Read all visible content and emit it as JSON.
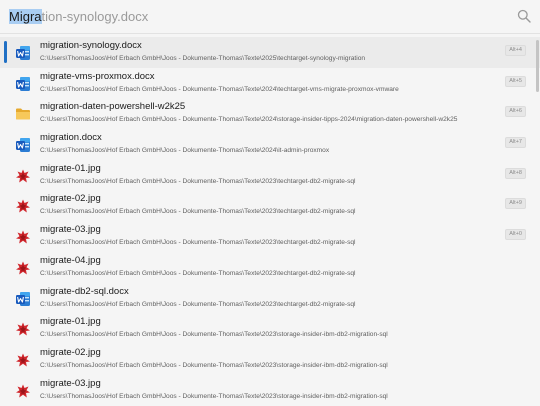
{
  "search": {
    "typed": "Migra",
    "completion": "tion-synology.docx"
  },
  "results": [
    {
      "title": "migration-synology.docx",
      "path": "C:\\Users\\ThomasJoos\\Hof Erbach GmbH\\Joos - Dokumente-Thomas\\Texte\\2025\\techtarget-synology-migration",
      "icon": "word-document-icon",
      "shortcut": "Alt+4",
      "selected": true
    },
    {
      "title": "migrate-vms-proxmox.docx",
      "path": "C:\\Users\\ThomasJoos\\Hof Erbach GmbH\\Joos - Dokumente-Thomas\\Texte\\2024\\techtarget-vms-migrate-proxmox-vmware",
      "icon": "word-document-icon",
      "shortcut": "Alt+5"
    },
    {
      "title": "migration-daten-powershell-w2k25",
      "path": "C:\\Users\\ThomasJoos\\Hof Erbach GmbH\\Joos - Dokumente-Thomas\\Texte\\2024\\storage-insider-tipps-2024\\migration-daten-powershell-w2k25",
      "icon": "folder-icon",
      "shortcut": "Alt+6"
    },
    {
      "title": "migration.docx",
      "path": "C:\\Users\\ThomasJoos\\Hof Erbach GmbH\\Joos - Dokumente-Thomas\\Texte\\2024\\it-admin-proxmox",
      "icon": "word-document-icon",
      "shortcut": "Alt+7"
    },
    {
      "title": "migrate-01.jpg",
      "path": "C:\\Users\\ThomasJoos\\Hof Erbach GmbH\\Joos - Dokumente-Thomas\\Texte\\2023\\techtarget-db2-migrate-sql",
      "icon": "image-file-icon",
      "shortcut": "Alt+8"
    },
    {
      "title": "migrate-02.jpg",
      "path": "C:\\Users\\ThomasJoos\\Hof Erbach GmbH\\Joos - Dokumente-Thomas\\Texte\\2023\\techtarget-db2-migrate-sql",
      "icon": "image-file-icon",
      "shortcut": "Alt+9"
    },
    {
      "title": "migrate-03.jpg",
      "path": "C:\\Users\\ThomasJoos\\Hof Erbach GmbH\\Joos - Dokumente-Thomas\\Texte\\2023\\techtarget-db2-migrate-sql",
      "icon": "image-file-icon",
      "shortcut": "Alt+0"
    },
    {
      "title": "migrate-04.jpg",
      "path": "C:\\Users\\ThomasJoos\\Hof Erbach GmbH\\Joos - Dokumente-Thomas\\Texte\\2023\\techtarget-db2-migrate-sql",
      "icon": "image-file-icon",
      "shortcut": ""
    },
    {
      "title": "migrate-db2-sql.docx",
      "path": "C:\\Users\\ThomasJoos\\Hof Erbach GmbH\\Joos - Dokumente-Thomas\\Texte\\2023\\techtarget-db2-migrate-sql",
      "icon": "word-document-icon",
      "shortcut": ""
    },
    {
      "title": "migrate-01.jpg",
      "path": "C:\\Users\\ThomasJoos\\Hof Erbach GmbH\\Joos - Dokumente-Thomas\\Texte\\2023\\storage-insider-ibm-db2-migration-sql",
      "icon": "image-file-icon",
      "shortcut": ""
    },
    {
      "title": "migrate-02.jpg",
      "path": "C:\\Users\\ThomasJoos\\Hof Erbach GmbH\\Joos - Dokumente-Thomas\\Texte\\2023\\storage-insider-ibm-db2-migration-sql",
      "icon": "image-file-icon",
      "shortcut": ""
    },
    {
      "title": "migrate-03.jpg",
      "path": "C:\\Users\\ThomasJoos\\Hof Erbach GmbH\\Joos - Dokumente-Thomas\\Texte\\2023\\storage-insider-ibm-db2-migration-sql",
      "icon": "image-file-icon",
      "shortcut": ""
    }
  ],
  "colors": {
    "accent": "#1f6fc4",
    "selection_highlight": "#a9cdf2",
    "word_blue": "#185abd",
    "folder_yellow": "#f5c24c",
    "image_red": "#c8252c"
  }
}
